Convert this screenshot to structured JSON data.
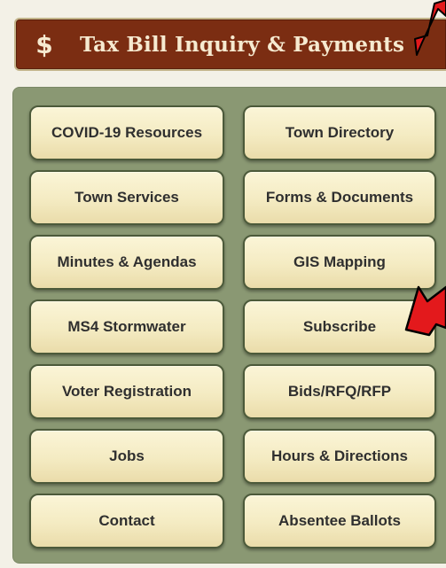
{
  "tax_banner": {
    "icon": "dollar-sign",
    "symbol": "$",
    "title": "Tax Bill Inquiry & Payments",
    "bg_color": "#7b2d12",
    "text_color": "#f6ead0"
  },
  "panel": {
    "bg_color": "#8a9873",
    "button_color": "#f4ebc2",
    "buttons": [
      {
        "label": "COVID-19 Resources"
      },
      {
        "label": "Town Directory"
      },
      {
        "label": "Town Services"
      },
      {
        "label": "Forms & Documents"
      },
      {
        "label": "Minutes & Agendas"
      },
      {
        "label": "GIS Mapping"
      },
      {
        "label": "MS4 Stormwater"
      },
      {
        "label": "Subscribe"
      },
      {
        "label": "Voter Registration"
      },
      {
        "label": "Bids/RFQ/RFP"
      },
      {
        "label": "Jobs"
      },
      {
        "label": "Hours & Directions"
      },
      {
        "label": "Contact"
      },
      {
        "label": "Absentee Ballots"
      }
    ]
  },
  "annotations": {
    "arrow_color": "#e3191c",
    "arrows": [
      "arrow-icon",
      "arrow-icon"
    ]
  }
}
